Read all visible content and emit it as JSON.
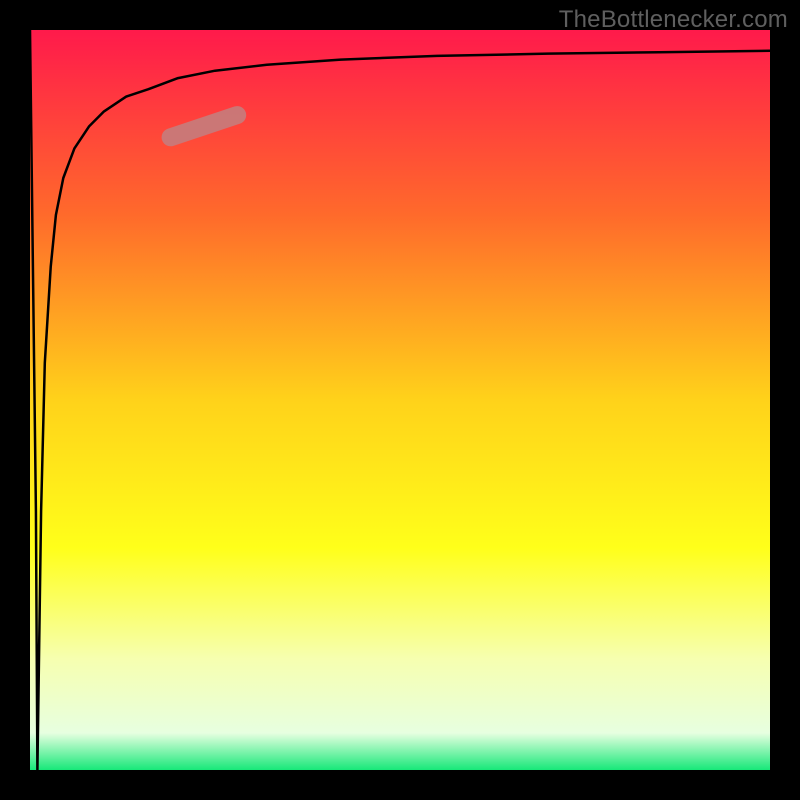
{
  "attribution": "TheBottlenecker.com",
  "chart_data": {
    "type": "line",
    "title": "",
    "xlabel": "",
    "ylabel": "",
    "xlim": [
      0,
      100
    ],
    "ylim": [
      0,
      100
    ],
    "grid": false,
    "legend": false,
    "background_gradient": {
      "stops": [
        {
          "offset": 0.0,
          "color": "#ff1a4b"
        },
        {
          "offset": 0.25,
          "color": "#ff6a2b"
        },
        {
          "offset": 0.5,
          "color": "#ffd21a"
        },
        {
          "offset": 0.7,
          "color": "#ffff1a"
        },
        {
          "offset": 0.85,
          "color": "#f6ffb0"
        },
        {
          "offset": 0.95,
          "color": "#e7ffe0"
        },
        {
          "offset": 1.0,
          "color": "#17e879"
        }
      ]
    },
    "frame_color": "#000000",
    "frame_thickness_px": 30,
    "series": [
      {
        "name": "bottleneck-curve",
        "color": "#000000",
        "thickness_px": 2.5,
        "x": [
          0,
          0.8,
          1.0,
          1.5,
          2.0,
          2.8,
          3.5,
          4.5,
          6.0,
          8.0,
          10,
          13,
          16,
          20,
          25,
          32,
          42,
          55,
          70,
          85,
          100
        ],
        "y": [
          100,
          35,
          0,
          35,
          55,
          68,
          75,
          80,
          84,
          87,
          89,
          91,
          92,
          93.5,
          94.5,
          95.3,
          96,
          96.5,
          96.8,
          97,
          97.2
        ]
      }
    ],
    "marker": {
      "name": "highlight-pill",
      "color": "#c97a7a",
      "opacity": 0.95,
      "x_range": [
        19,
        28
      ],
      "y_range": [
        85.5,
        88.5
      ],
      "thickness_px": 18
    }
  }
}
